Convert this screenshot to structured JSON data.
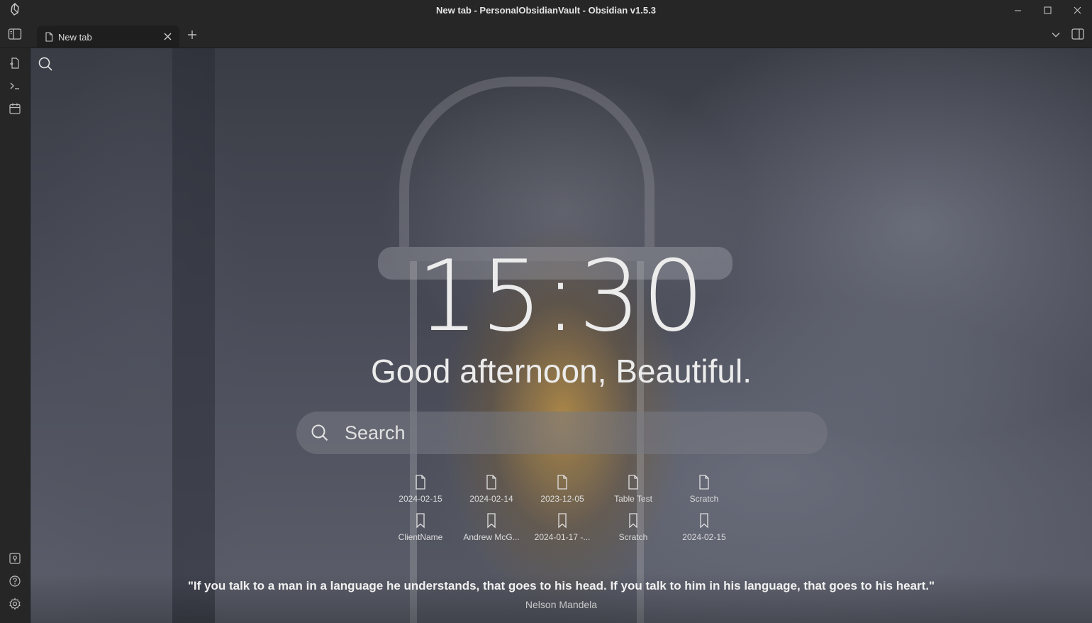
{
  "window": {
    "title": "New tab - PersonalObsidianVault - Obsidian v1.5.3"
  },
  "tabs": [
    {
      "label": "New tab",
      "active": true
    }
  ],
  "new_tab": {
    "clock": "15:30",
    "greeting": "Good afternoon, Beautiful.",
    "search_placeholder": "Search",
    "recent_files": [
      {
        "label": "2024-02-15",
        "icon": "file-icon"
      },
      {
        "label": "2024-02-14",
        "icon": "file-icon"
      },
      {
        "label": "2023-12-05",
        "icon": "file-icon"
      },
      {
        "label": "Table Test",
        "icon": "file-icon"
      },
      {
        "label": "Scratch",
        "icon": "file-icon"
      }
    ],
    "bookmarks": [
      {
        "label": "ClientName",
        "icon": "bookmark-icon"
      },
      {
        "label": "Andrew McG...",
        "icon": "bookmark-icon"
      },
      {
        "label": "2024-01-17 -...",
        "icon": "bookmark-icon"
      },
      {
        "label": "Scratch",
        "icon": "bookmark-icon"
      },
      {
        "label": "2024-02-15",
        "icon": "bookmark-icon"
      }
    ],
    "quote": "\"If you talk to a man in a language he understands, that goes to his head. If you talk to him in his language, that goes to his heart.\"",
    "quote_author": "Nelson Mandela"
  },
  "ribbon": {
    "top_icons": [
      "open-quick-switcher-icon",
      "terminal-icon",
      "calendar-icon"
    ],
    "bottom_icons": [
      "vault-switch-icon",
      "help-icon",
      "settings-icon"
    ]
  }
}
